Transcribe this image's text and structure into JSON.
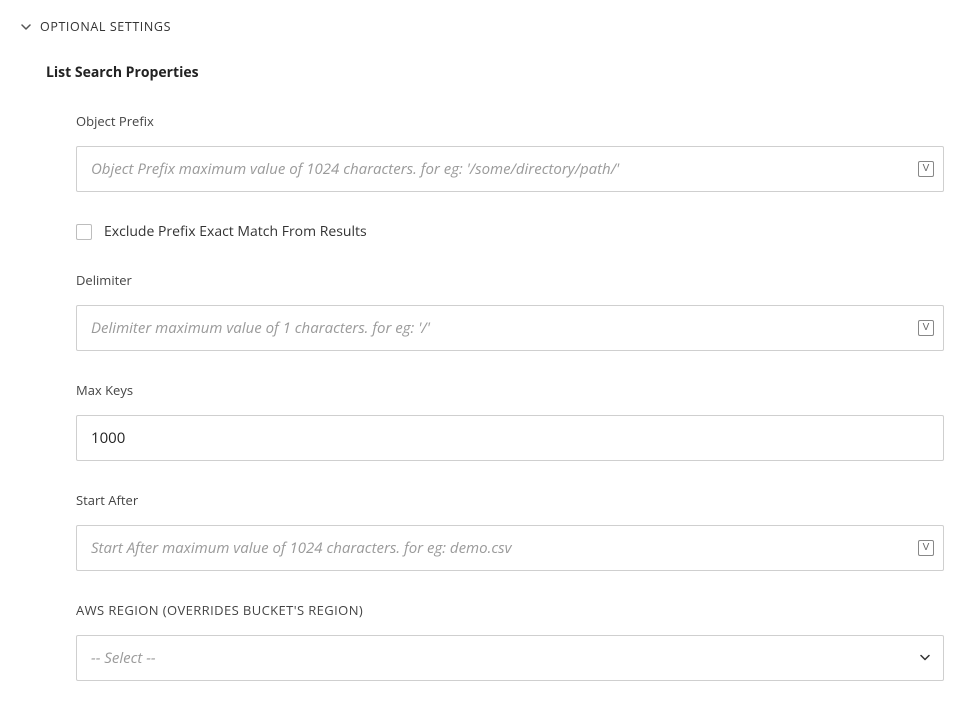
{
  "section": {
    "title": "OPTIONAL SETTINGS"
  },
  "subsection": {
    "title": "List Search Properties"
  },
  "fields": {
    "objectPrefix": {
      "label": "Object Prefix",
      "placeholder": "Object Prefix maximum value of 1024 characters. for eg: '/some/directory/path/'",
      "value": ""
    },
    "excludePrefix": {
      "label": "Exclude Prefix Exact Match From Results"
    },
    "delimiter": {
      "label": "Delimiter",
      "placeholder": "Delimiter maximum value of 1 characters. for eg: '/'",
      "value": ""
    },
    "maxKeys": {
      "label": "Max Keys",
      "value": "1000",
      "placeholder": ""
    },
    "startAfter": {
      "label": "Start After",
      "placeholder": "Start After maximum value of 1024 characters. for eg: demo.csv",
      "value": ""
    },
    "awsRegion": {
      "label": "AWS REGION (OVERRIDES BUCKET'S REGION)",
      "selected": "-- Select --"
    }
  },
  "icons": {
    "variable": "V"
  }
}
